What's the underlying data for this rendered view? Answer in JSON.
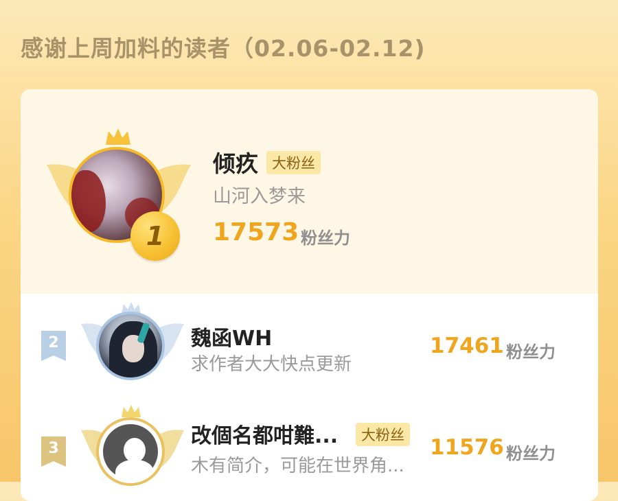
{
  "title": "感谢上周加料的读者（02.06-02.12)",
  "colors": {
    "accent": "#f0a51f",
    "gold": "#f6b92a",
    "silver_blue": "#a9c5e3",
    "badge_bg": "#fbe7a6"
  },
  "readers": [
    {
      "rank": "1",
      "name": "倾疚",
      "badge": "大粉丝",
      "bio": "山河入梦来",
      "score": "17573",
      "unit": "粉丝力"
    },
    {
      "rank": "2",
      "name": "魏函WH",
      "badge": "",
      "bio": "求作者大大快点更新",
      "score": "17461",
      "unit": "粉丝力"
    },
    {
      "rank": "3",
      "name": "改個名都咁難...",
      "badge": "大粉丝",
      "bio": "木有简介，可能在世界角...",
      "score": "11576",
      "unit": "粉丝力"
    }
  ]
}
